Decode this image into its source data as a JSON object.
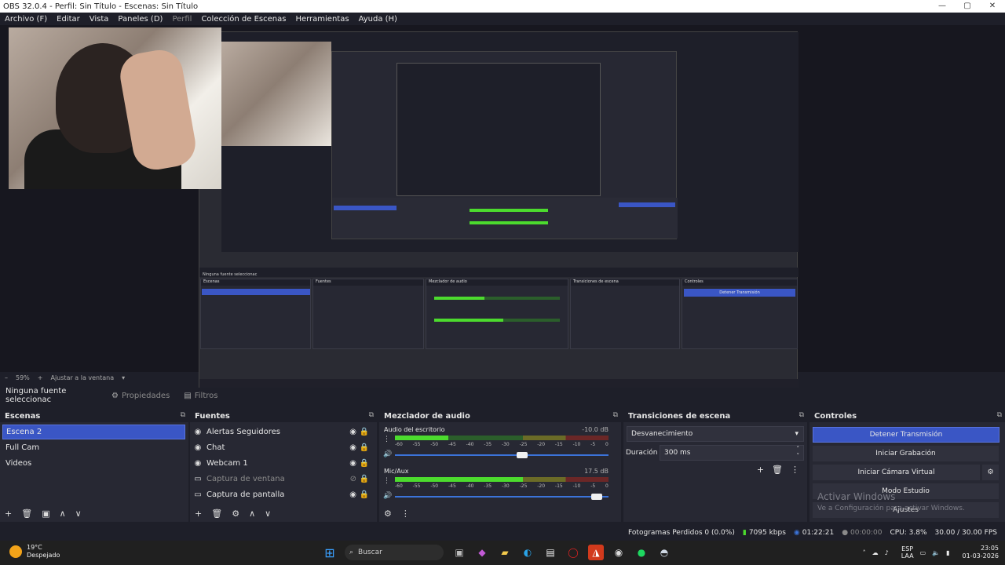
{
  "window": {
    "title": "OBS 32.0.4 - Perfil: Sin Título - Escenas: Sin Título",
    "controls": [
      "—",
      "▢",
      "✕"
    ]
  },
  "menu": [
    {
      "label": "Archivo (F)",
      "dim": false
    },
    {
      "label": "Editar",
      "dim": false
    },
    {
      "label": "Vista",
      "dim": false
    },
    {
      "label": "Paneles (D)",
      "dim": false
    },
    {
      "label": "Perfil",
      "dim": true
    },
    {
      "label": "Colección de Escenas",
      "dim": false
    },
    {
      "label": "Herramientas",
      "dim": false
    },
    {
      "label": "Ayuda (H)",
      "dim": false
    }
  ],
  "preview_toolbar": {
    "minus": "–",
    "zoom": "59%",
    "plus": "+",
    "fit": "Ajustar a la ventana",
    "caret": "▾"
  },
  "context": {
    "no_source": "Ninguna fuente seleccionac",
    "properties": "Propiedades",
    "filters": "Filtros"
  },
  "scenes": {
    "title": "Escenas",
    "items": [
      {
        "label": "Escena 2",
        "selected": true
      },
      {
        "label": "Full Cam",
        "selected": false
      },
      {
        "label": "Videos",
        "selected": false
      }
    ],
    "footer": [
      "+",
      "🗑",
      "▣",
      "∧",
      "∨"
    ]
  },
  "sources": {
    "title": "Fuentes",
    "items": [
      {
        "label": "Alertas Seguidores",
        "icon": "globe-icon",
        "glyph": "◉",
        "visible": true
      },
      {
        "label": "Chat",
        "icon": "globe-icon",
        "glyph": "◉",
        "visible": true
      },
      {
        "label": "Webcam 1",
        "icon": "globe-icon",
        "glyph": "◉",
        "visible": true
      },
      {
        "label": "Captura de ventana",
        "icon": "window-capture-icon",
        "glyph": "▭",
        "visible": false
      },
      {
        "label": "Captura de pantalla",
        "icon": "display-capture-icon",
        "glyph": "▭",
        "visible": true
      }
    ],
    "footer": [
      "+",
      "🗑",
      "⚙",
      "∧",
      "∨"
    ]
  },
  "mixer": {
    "title": "Mezclador de audio",
    "channels": [
      {
        "name": "Audio del escritorio",
        "db": "-10.0 dB",
        "level": 0.25,
        "volume": 0.62
      },
      {
        "name": "Mic/Aux",
        "db": "17.5 dB",
        "level": 0.6,
        "volume": 0.97
      }
    ],
    "scale": [
      "-60",
      "-55",
      "-50",
      "-45",
      "-40",
      "-35",
      "-30",
      "-25",
      "-20",
      "-15",
      "-10",
      "-5",
      "0"
    ],
    "footer": [
      "⚙",
      "⋮"
    ]
  },
  "transitions": {
    "title": "Transiciones de escena",
    "type": "Desvanecimiento",
    "duration_label": "Duración",
    "duration_value": "300 ms",
    "footer": [
      "+",
      "🗑",
      "⋮"
    ]
  },
  "controls": {
    "title": "Controles",
    "stop_stream": "Detener Transmisión",
    "start_recording": "Iniciar Grabación",
    "start_virtual_cam": "Iniciar Cámara Virtual",
    "studio_mode": "Modo Estudio",
    "settings": "Ajustes"
  },
  "watermark": {
    "title": "Activar Windows",
    "text": "Ve a Configuración para activar Windows."
  },
  "status": {
    "dropped": "Fotogramas Perdidos 0 (0.0%)",
    "bitrate": "7095 kbps",
    "stream_time": "01:22:21",
    "rec_time": "00:00:00",
    "cpu": "CPU: 3.8%",
    "fps": "30.00 / 30.00 FPS"
  },
  "taskbar": {
    "temp": "19°C",
    "weather": "Despejado",
    "search": "Buscar",
    "lang": "ESP",
    "lang2": "LAA",
    "time": "23:05",
    "date": "01-03-2026"
  },
  "mini": {
    "scenes_title": "Escenas",
    "sources_title": "Fuentes",
    "mixer_title": "Mezclador de audio",
    "trans_title": "Transiciones de escena",
    "controls_title": "Controles",
    "no_source": "Ninguna fuente seleccionac",
    "stop": "Detener Transmisión"
  },
  "colors": {
    "accent": "#3a56c5",
    "bg": "#1e1f29",
    "panel": "#272833",
    "meter_green": "#4cdb2e"
  }
}
